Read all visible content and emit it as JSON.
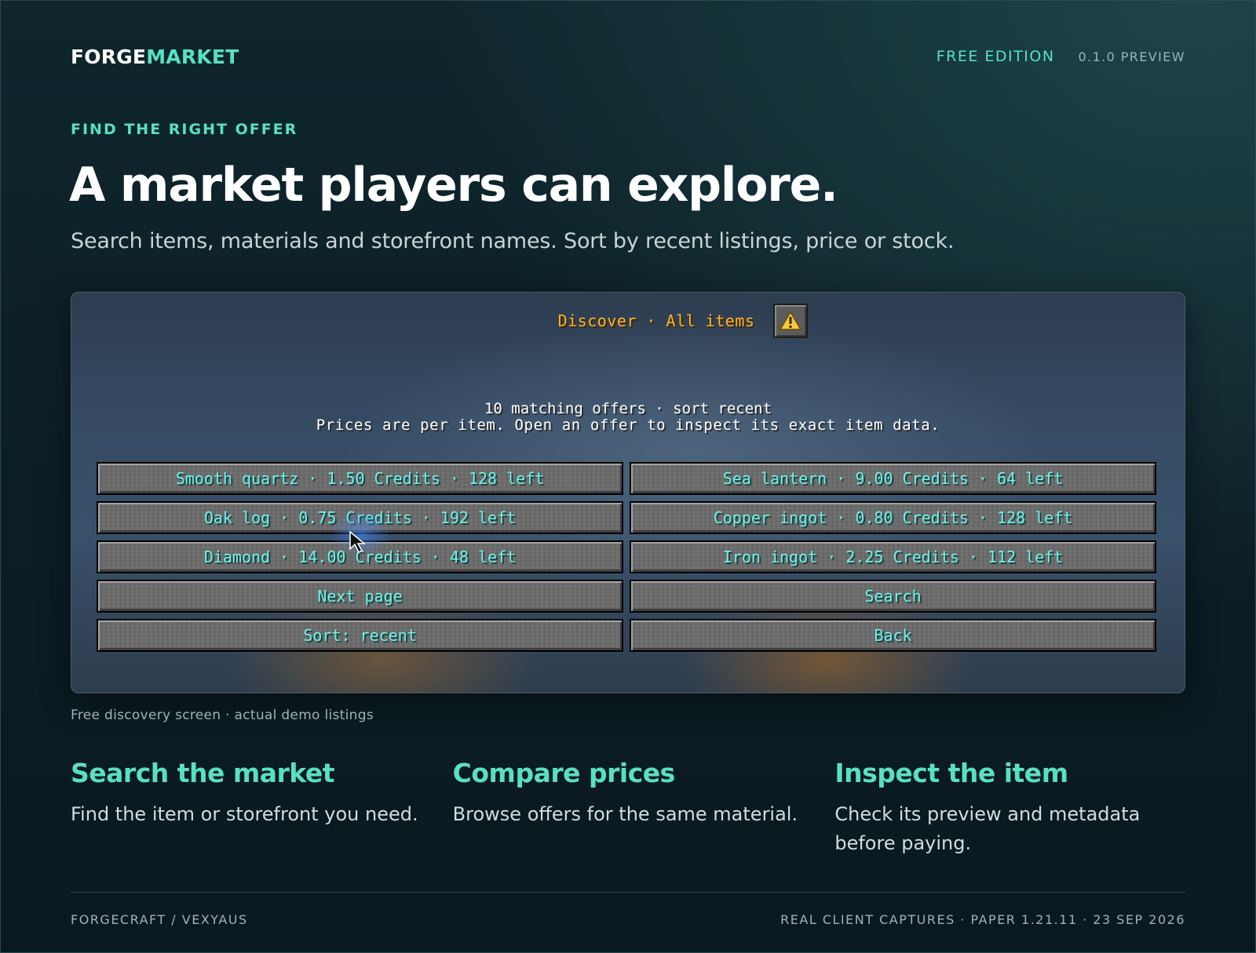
{
  "header": {
    "brand_part1": "FORGE",
    "brand_part2": "MARKET",
    "edition": "FREE EDITION",
    "version": "0.1.0 PREVIEW"
  },
  "hero": {
    "eyebrow": "FIND THE RIGHT OFFER",
    "title": "A market players can explore.",
    "subtitle": "Search items, materials and storefront names. Sort by recent listings, price or stock."
  },
  "game_screen": {
    "title": "Discover · All items",
    "warning_icon": "warning-triangle-icon",
    "status_line1": "10 matching offers · sort recent",
    "status_line2": "Prices are per item. Open an offer to inspect its exact item data.",
    "buttons": [
      "Smooth quartz · 1.50 Credits · 128 left",
      "Sea lantern · 9.00 Credits · 64 left",
      "Oak log · 0.75 Credits · 192 left",
      "Copper ingot · 0.80 Credits · 128 left",
      "Diamond · 14.00 Credits · 48 left",
      "Iron ingot · 2.25 Credits · 112 left",
      "Next page",
      "Search",
      "Sort: recent",
      "Back"
    ]
  },
  "caption": "Free discovery screen · actual demo listings",
  "features": [
    {
      "title": "Search the market",
      "text": "Find the item or storefront you need."
    },
    {
      "title": "Compare prices",
      "text": "Browse offers for the same material."
    },
    {
      "title": "Inspect the item",
      "text": "Check its preview and metadata before paying."
    }
  ],
  "footer": {
    "left": "FORGECRAFT / VEXYAUS",
    "right": "REAL CLIENT CAPTURES · PAPER 1.21.11 · 23 SEP 2026"
  },
  "colors": {
    "accent": "#58e0c4",
    "background": "#0c1d24",
    "game_title": "#ffb22c",
    "game_button_text": "#6ff0e8"
  }
}
